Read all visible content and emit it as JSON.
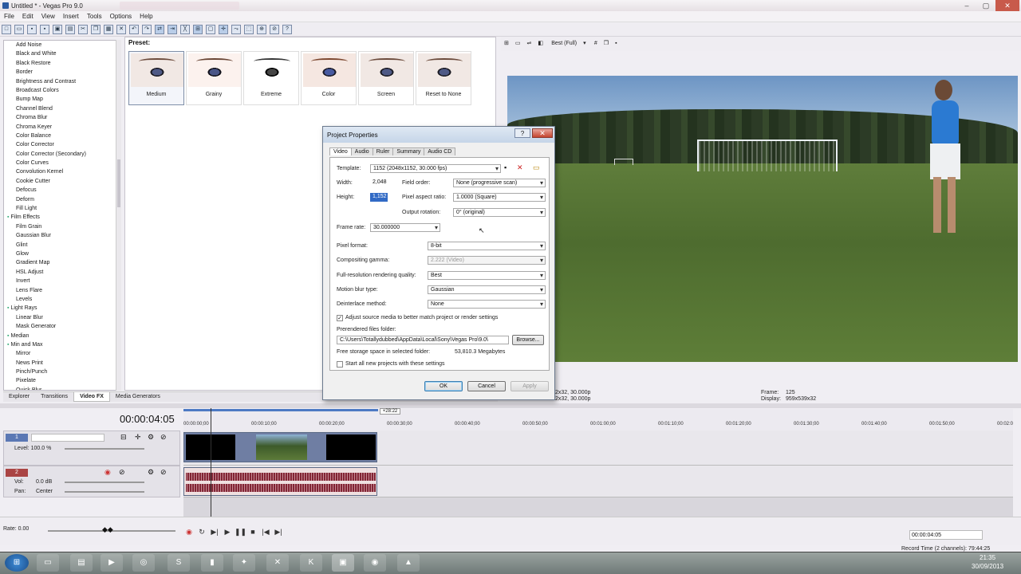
{
  "window": {
    "title": "Untitled * - Vegas Pro 9.0",
    "controls": [
      "–",
      "▢",
      "✕"
    ]
  },
  "menu": [
    "File",
    "Edit",
    "View",
    "Insert",
    "Tools",
    "Options",
    "Help"
  ],
  "fx": {
    "items": [
      {
        "label": "Add Noise",
        "folder": false
      },
      {
        "label": "Black and White",
        "folder": false
      },
      {
        "label": "Black Restore",
        "folder": false
      },
      {
        "label": "Border",
        "folder": false
      },
      {
        "label": "Brightness and Contrast",
        "folder": false
      },
      {
        "label": "Broadcast Colors",
        "folder": false
      },
      {
        "label": "Bump Map",
        "folder": false
      },
      {
        "label": "Channel Blend",
        "folder": false
      },
      {
        "label": "Chroma Blur",
        "folder": false
      },
      {
        "label": "Chroma Keyer",
        "folder": false
      },
      {
        "label": "Color Balance",
        "folder": false
      },
      {
        "label": "Color Corrector",
        "folder": false
      },
      {
        "label": "Color Corrector (Secondary)",
        "folder": false
      },
      {
        "label": "Color Curves",
        "folder": false
      },
      {
        "label": "Convolution Kernel",
        "folder": false
      },
      {
        "label": "Cookie Cutter",
        "folder": false
      },
      {
        "label": "Defocus",
        "folder": false
      },
      {
        "label": "Deform",
        "folder": false
      },
      {
        "label": "Fill Light",
        "folder": false
      },
      {
        "label": "Film Effects",
        "folder": true
      },
      {
        "label": "Film Grain",
        "folder": false
      },
      {
        "label": "Gaussian Blur",
        "folder": false
      },
      {
        "label": "Glint",
        "folder": false
      },
      {
        "label": "Glow",
        "folder": false
      },
      {
        "label": "Gradient Map",
        "folder": false
      },
      {
        "label": "HSL Adjust",
        "folder": false
      },
      {
        "label": "Invert",
        "folder": false
      },
      {
        "label": "Lens Flare",
        "folder": false
      },
      {
        "label": "Levels",
        "folder": false
      },
      {
        "label": "Light Rays",
        "folder": true
      },
      {
        "label": "Linear Blur",
        "folder": false
      },
      {
        "label": "Mask Generator",
        "folder": false
      },
      {
        "label": "Median",
        "folder": true
      },
      {
        "label": "Min and Max",
        "folder": true
      },
      {
        "label": "Mirror",
        "folder": false
      },
      {
        "label": "News Print",
        "folder": false
      },
      {
        "label": "Pinch/Punch",
        "folder": false
      },
      {
        "label": "Pixelate",
        "folder": false
      },
      {
        "label": "Quick Blur",
        "folder": false
      }
    ]
  },
  "preset": {
    "label": "Preset:",
    "items": [
      "Medium",
      "Grainy",
      "Extreme",
      "Color",
      "Screen",
      "Reset to None"
    ]
  },
  "panel_tabs": [
    "Explorer",
    "Transitions",
    "Video FX",
    "Media Generators"
  ],
  "preview": {
    "quality": "Best (Full)",
    "frame_label": "Frame:",
    "frame": "125",
    "display_label": "Display:",
    "display": "959x539x32",
    "project_partial": "2x32, 30.000p",
    "preview_partial": "2x32, 30.000p"
  },
  "dialog": {
    "title": "Project Properties",
    "help": "?",
    "close": "✕",
    "tabs": [
      "Video",
      "Audio",
      "Ruler",
      "Summary",
      "Audio CD"
    ],
    "template_label": "Template:",
    "template": "1152 (2048x1152, 30.000 fps)",
    "width_label": "Width:",
    "width": "2,048",
    "height_label": "Height:",
    "height": "1,152",
    "field_order_label": "Field order:",
    "field_order": "None (progressive scan)",
    "par_label": "Pixel aspect ratio:",
    "par": "1.0000 (Square)",
    "rotation_label": "Output rotation:",
    "rotation": "0° (original)",
    "fps_label": "Frame rate:",
    "fps": "30.000000",
    "pixfmt_label": "Pixel format:",
    "pixfmt": "8-bit",
    "gamma_label": "Compositing gamma:",
    "gamma": "2.222 (Video)",
    "quality_label": "Full-resolution rendering quality:",
    "quality": "Best",
    "mblur_label": "Motion blur type:",
    "mblur": "Gaussian",
    "deint_label": "Deinterlace method:",
    "deint": "None",
    "adjust_label": "Adjust source media to better match project or render settings",
    "prerender_label": "Prerendered files folder:",
    "prerender": "C:\\Users\\Totallydubbed\\AppData\\Local\\Sony\\Vegas Pro\\9.0\\",
    "browse": "Browse...",
    "free_label": "Free storage space in selected folder:",
    "free": "53,810.3 Megabytes",
    "startall_label": "Start all new projects with these settings",
    "ok": "OK",
    "cancel": "Cancel",
    "apply": "Apply"
  },
  "timeline": {
    "timecode": "00:00:04:05",
    "marker": "+28:22",
    "ruler": [
      "00:00:00;00",
      "00:00:10;00",
      "00:00:20;00",
      "00:00:30;00",
      "00:00:40;00",
      "00:00:50;00",
      "00:01:00;00",
      "00:01:10;00",
      "00:01:20;00",
      "00:01:30;00",
      "00:01:40;00",
      "00:01:50;00",
      "00:02:0"
    ],
    "video_track": {
      "number": "1",
      "level": "Level: 100.0 %"
    },
    "audio_track": {
      "number": "2",
      "vol_label": "Vol:",
      "vol": "0.0 dB",
      "pan_label": "Pan:",
      "pan": "Center"
    },
    "rate": "Rate: 0.00",
    "end_time": "00:00:04:05",
    "record_time": "Record Time (2 channels): 79:44:25"
  },
  "taskbar": {
    "time": "21:35",
    "date": "30/09/2013"
  }
}
